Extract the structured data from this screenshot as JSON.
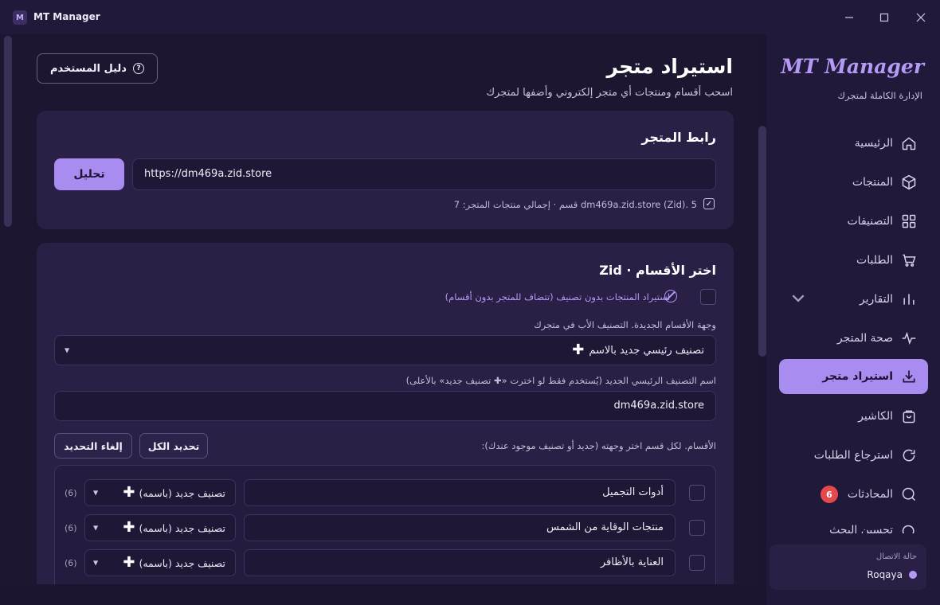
{
  "window": {
    "title": "MT Manager",
    "logo_letter": "M"
  },
  "header": {
    "title": "استيراد متجر",
    "subtitle": "اسحب أقسام ومنتجات أي متجر إلكتروني وأضفها لمتجرك",
    "guide_button": "دليل المستخدم"
  },
  "store_link": {
    "title": "رابط المتجر",
    "url": "https://dm469a.zid.store",
    "analyze_button": "تحليل",
    "result_text": "dm469a.zid.store (Zid). 5 قسم · إجمالي منتجات المتجر: 7"
  },
  "sections": {
    "title": "اختر الأقسام · Zid",
    "no_category_option": "استيراد المنتجات بدون تصنيف (تتضاف للمتجر بدون أقسام)",
    "destination_label": "وجهة الأقسام الجديدة. التصنيف الأب في متجرك",
    "destination_value": "تصنيف رئيسي جديد بالاسم",
    "new_main_label": "اسم التصنيف الرئيسي الجديد (يُستخدم فقط لو اخترت «✚ تصنيف جديد» بالأعلى)",
    "new_main_value": "dm469a.zid.store",
    "list_hint": "الأقسام. لكل قسم اختر وجهته (جديد أو تصنيف موجود عندك):",
    "select_all": "تحديد الكل",
    "deselect": "إلغاء التحديد",
    "rows": [
      {
        "name": "أدوات التجميل",
        "target": "تصنيف جديد (باسمه)",
        "count": "(6)"
      },
      {
        "name": "منتجات الوقاية من الشمس",
        "target": "تصنيف جديد (باسمه)",
        "count": "(6)"
      },
      {
        "name": "العناية بالأظافر",
        "target": "تصنيف جديد (باسمه)",
        "count": "(6)"
      }
    ]
  },
  "sidebar": {
    "brand": "MT Manager",
    "brand_sub": "الإدارة الكاملة لمتجرك",
    "items": [
      {
        "label": "الرئيسية",
        "icon": "home-icon"
      },
      {
        "label": "المنتجات",
        "icon": "box-icon"
      },
      {
        "label": "التصنيفات",
        "icon": "grid-icon"
      },
      {
        "label": "الطلبات",
        "icon": "cart-icon"
      },
      {
        "label": "التقارير",
        "icon": "chart-icon"
      },
      {
        "label": "صحة المتجر",
        "icon": "pulse-icon"
      },
      {
        "label": "استيراد متجر",
        "icon": "download-icon",
        "active": true
      },
      {
        "label": "الكاشير",
        "icon": "bag-icon"
      },
      {
        "label": "استرجاع الطلبات",
        "icon": "refresh-icon"
      },
      {
        "label": "المحادثات",
        "icon": "chat-icon",
        "badge": "6"
      },
      {
        "label": "تحسين البحث",
        "icon": "search-icon"
      }
    ],
    "connection": {
      "label": "حالة الاتصال",
      "user": "Roqaya"
    }
  },
  "colors": {
    "accent": "#a98cf0",
    "badge": "#e5484d"
  }
}
